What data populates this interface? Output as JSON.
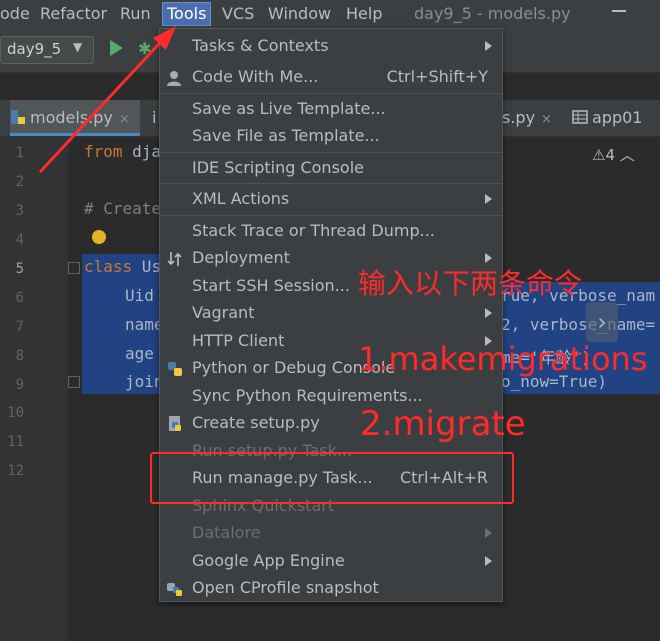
{
  "menubar": {
    "items": [
      "ode",
      "Refactor",
      "Run",
      "Tools",
      "VCS",
      "Window",
      "Help"
    ],
    "window_title": "day9_5 - models.py"
  },
  "toolbar": {
    "run_config": "day9_5"
  },
  "tabs": [
    {
      "label": "models.py",
      "close": "×"
    },
    {
      "label": "i",
      "close": ""
    },
    {
      "label": "s.py",
      "close": "×"
    },
    {
      "label": "app01",
      "close": ""
    }
  ],
  "editor": {
    "line_numbers": [
      "1",
      "2",
      "3",
      "4",
      "5",
      "6",
      "7",
      "8",
      "9",
      "10",
      "11",
      "12"
    ],
    "lines": {
      "l1_kw": "from",
      "l1_rest": " dja",
      "l3": "# Create",
      "l5_kw": "class",
      "l5_rest": " Us",
      "l6": "Uid",
      "l7": "name",
      "l8": "age",
      "l9": "join",
      "r6": "rue, verbose_nam",
      "r7": "2, verbose_name=",
      "r8": "me='年龄')",
      "r9": "o_now=True)"
    },
    "warning_count": "4"
  },
  "tools_menu": {
    "items": [
      {
        "label": "Tasks & Contexts",
        "shortcut": "",
        "submenu": true,
        "disabled": false
      },
      {
        "label": "Code With Me...",
        "shortcut": "Ctrl+Shift+Y",
        "submenu": false,
        "disabled": false
      },
      {
        "label": "Save as Live Template...",
        "shortcut": "",
        "submenu": false,
        "disabled": false
      },
      {
        "label": "Save File as Template...",
        "shortcut": "",
        "submenu": false,
        "disabled": false
      },
      {
        "label": "IDE Scripting Console",
        "shortcut": "",
        "submenu": false,
        "disabled": false
      },
      {
        "label": "XML Actions",
        "shortcut": "",
        "submenu": true,
        "disabled": false
      },
      {
        "label": "Stack Trace or Thread Dump...",
        "shortcut": "",
        "submenu": false,
        "disabled": false
      },
      {
        "label": "Deployment",
        "shortcut": "",
        "submenu": true,
        "disabled": false
      },
      {
        "label": "Start SSH Session...",
        "shortcut": "",
        "submenu": false,
        "disabled": false
      },
      {
        "label": "Vagrant",
        "shortcut": "",
        "submenu": true,
        "disabled": false
      },
      {
        "label": "HTTP Client",
        "shortcut": "",
        "submenu": true,
        "disabled": false
      },
      {
        "label": "Python or Debug Console",
        "shortcut": "",
        "submenu": false,
        "disabled": false
      },
      {
        "label": "Sync Python Requirements...",
        "shortcut": "",
        "submenu": false,
        "disabled": false
      },
      {
        "label": "Create setup.py",
        "shortcut": "",
        "submenu": false,
        "disabled": false
      },
      {
        "label": "Run setup.py Task...",
        "shortcut": "",
        "submenu": false,
        "disabled": true
      },
      {
        "label": "Run manage.py Task...",
        "shortcut": "Ctrl+Alt+R",
        "submenu": false,
        "disabled": false
      },
      {
        "label": "Sphinx Quickstart",
        "shortcut": "",
        "submenu": false,
        "disabled": true
      },
      {
        "label": "Datalore",
        "shortcut": "",
        "submenu": true,
        "disabled": true
      },
      {
        "label": "Google App Engine",
        "shortcut": "",
        "submenu": true,
        "disabled": false
      },
      {
        "label": "Open CProfile snapshot",
        "shortcut": "",
        "submenu": false,
        "disabled": false
      }
    ]
  },
  "annotations": {
    "instruction": "输入以下两条命令",
    "step1": "1.makemigrations",
    "step2": "2.migrate",
    "color": "#ff2a2a"
  },
  "colors": {
    "menu_bg": "#3c3f41",
    "editor_bg": "#2b2b2b",
    "selection": "#214283",
    "accent": "#4b6eaf",
    "annotation": "#ff2a2a"
  }
}
